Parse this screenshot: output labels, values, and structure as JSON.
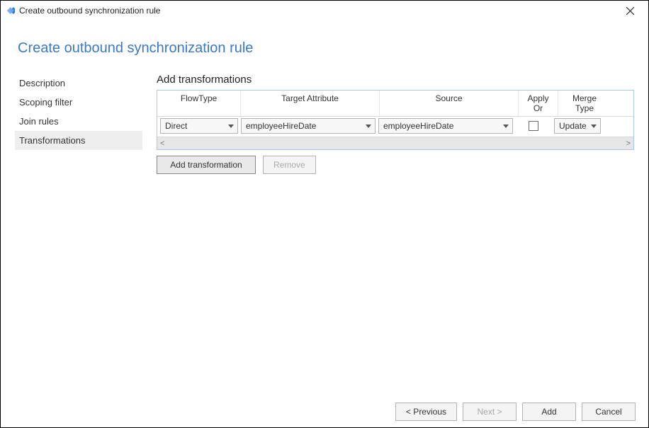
{
  "window": {
    "title": "Create outbound synchronization rule"
  },
  "page": {
    "title": "Create outbound synchronization rule"
  },
  "sidebar": {
    "items": [
      {
        "label": "Description",
        "active": false
      },
      {
        "label": "Scoping filter",
        "active": false
      },
      {
        "label": "Join rules",
        "active": false
      },
      {
        "label": "Transformations",
        "active": true
      }
    ]
  },
  "main": {
    "section_title": "Add transformations",
    "columns": {
      "flow": "FlowType",
      "target": "Target Attribute",
      "source": "Source",
      "apply": "Apply Or",
      "merge": "Merge Type"
    },
    "row": {
      "flow": "Direct",
      "target": "employeeHireDate",
      "source": "employeeHireDate",
      "apply_once": false,
      "merge": "Update"
    },
    "scroll": {
      "left": "<",
      "right": ">"
    },
    "buttons": {
      "add_transformation": "Add transformation",
      "remove": "Remove"
    }
  },
  "footer": {
    "previous": "< Previous",
    "next": "Next >",
    "add": "Add",
    "cancel": "Cancel"
  }
}
